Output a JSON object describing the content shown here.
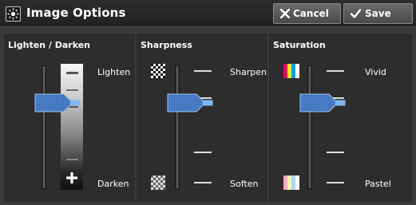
{
  "header": {
    "title": "Image Options",
    "cancel_label": "Cancel",
    "save_label": "Save"
  },
  "panels": [
    {
      "title": "Lighten / Darken",
      "top_label": "Lighten",
      "bottom_label": "Darken",
      "level_index": 3,
      "levels": 7
    },
    {
      "title": "Sharpness",
      "top_label": "Sharpen",
      "bottom_label": "Soften",
      "level_index": 2,
      "levels": 5
    },
    {
      "title": "Saturation",
      "top_label": "Vivid",
      "bottom_label": "Pastel",
      "level_index": 2,
      "levels": 5
    }
  ],
  "colors": {
    "background": "#3a3a3a",
    "panel": "#2d2d2d",
    "handle": "#4a7ec8",
    "handle_tip": "#6aaaf0"
  },
  "icons": {
    "header": "image-options-icon",
    "cancel": "x-icon",
    "save": "checkmark-icon",
    "sharpen": "checkerboard-icon",
    "soften": "checkerboard-icon",
    "vivid": "color-bars-icon",
    "pastel": "pastel-bars-icon"
  }
}
